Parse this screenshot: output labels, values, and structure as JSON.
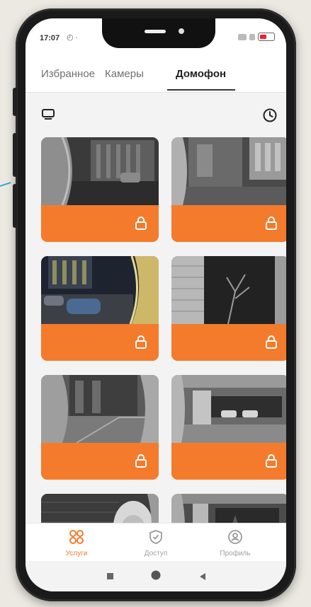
{
  "status": {
    "time": "17:07",
    "small": "◴ ·"
  },
  "tabs": [
    {
      "label": "Избранное"
    },
    {
      "label": "Камеры"
    },
    {
      "label": "Домофон"
    }
  ],
  "active_tab": "Домофон",
  "icons": {
    "tv": "monitor-icon",
    "history": "clock-icon",
    "lock": "lock-icon"
  },
  "colors": {
    "accent": "#f47b2c",
    "card_bar": "#f47b2c",
    "text": "#222222",
    "muted": "#a0a0a0"
  },
  "bottom_nav": [
    {
      "label": "Услуги",
      "active": true
    },
    {
      "label": "Доступ",
      "active": false
    },
    {
      "label": "Профиль",
      "active": false
    }
  ]
}
